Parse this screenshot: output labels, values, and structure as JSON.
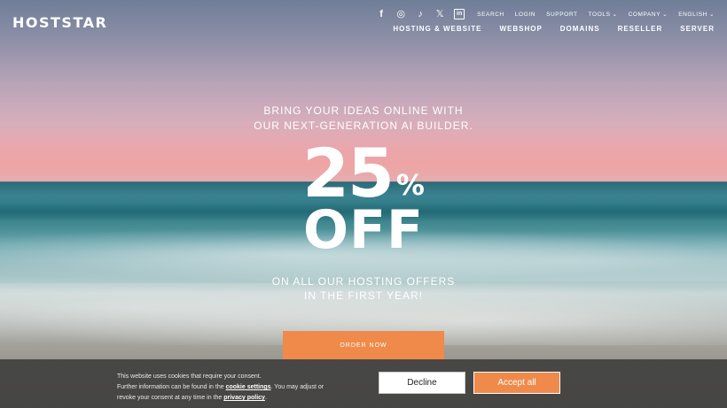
{
  "brand": {
    "logo": "HOSTSTAR"
  },
  "social": [
    {
      "icon": "facebook-icon",
      "glyph": "f"
    },
    {
      "icon": "instagram-icon",
      "glyph": "◎"
    },
    {
      "icon": "tiktok-icon",
      "glyph": "♪"
    },
    {
      "icon": "x-icon",
      "glyph": "𝕏"
    },
    {
      "icon": "linkedin-icon",
      "glyph": "in"
    }
  ],
  "util_nav": {
    "search": "SEARCH",
    "login": "LOGIN",
    "support": "SUPPORT",
    "tools": "TOOLS",
    "company": "COMPANY",
    "language": "ENGLISH"
  },
  "main_nav": {
    "hosting": "HOSTING & WEBSITE",
    "webshop": "WEBSHOP",
    "domains": "DOMAINS",
    "reseller": "RESELLER",
    "server": "SERVER"
  },
  "hero": {
    "tagline_1": "BRING YOUR IDEAS ONLINE WITH",
    "tagline_2": "OUR NEXT-GENERATION AI BUILDER.",
    "discount_number": "25",
    "discount_unit": "%",
    "discount_word": "OFF",
    "sub_1": "ON ALL OUR HOSTING OFFERS",
    "sub_2": "IN THE FIRST YEAR!",
    "cta": "ORDER NOW"
  },
  "cookie": {
    "line1": "This website uses cookies that require your consent.",
    "line2_pre": "Further information can be found in the ",
    "settings_link": "cookie settings",
    "line2_post": ". You may adjust or",
    "line3_pre": "revoke your consent at any time in the ",
    "privacy_link": "privacy policy",
    "line3_post": ".",
    "decline": "Decline",
    "accept": "Accept all"
  },
  "colors": {
    "accent": "#ef8a4a",
    "cookie_bg": "#3c3c3c"
  }
}
